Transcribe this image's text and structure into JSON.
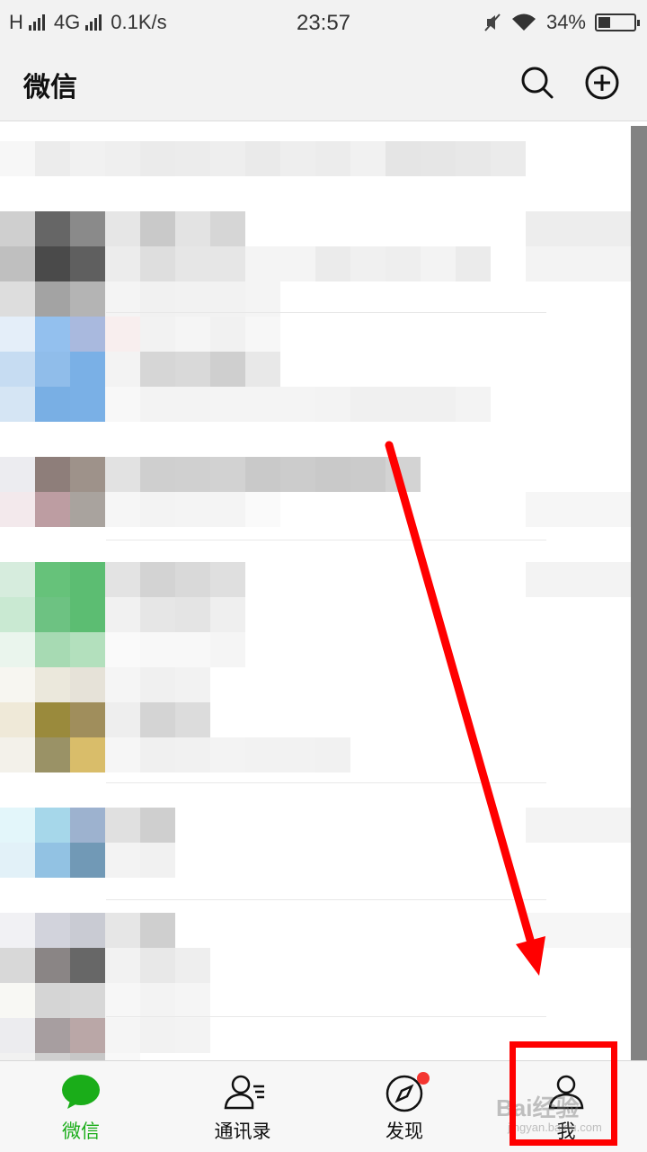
{
  "status_bar": {
    "network_left": "H",
    "network_mid": "4G",
    "speed": "0.1K/s",
    "time": "23:57",
    "battery_percent": "34%",
    "battery_level": 0.34,
    "icons": [
      "signal-icon",
      "mute-icon",
      "wifi-icon",
      "battery-icon"
    ]
  },
  "header": {
    "title": "微信",
    "icons": [
      "search-icon",
      "add-icon"
    ]
  },
  "tabs": [
    {
      "label": "微信",
      "icon": "chat-bubble-icon",
      "active": true
    },
    {
      "label": "通讯录",
      "icon": "contacts-icon",
      "active": false
    },
    {
      "label": "发现",
      "icon": "compass-icon",
      "active": false,
      "badge": true
    },
    {
      "label": "我",
      "icon": "me-icon",
      "active": false
    }
  ],
  "colors": {
    "accent": "#1aad19",
    "badge": "#f43530",
    "annotation": "#ff0000"
  },
  "watermark": {
    "text": "Bai经验",
    "subtext": "jingyan.baidu.com"
  }
}
